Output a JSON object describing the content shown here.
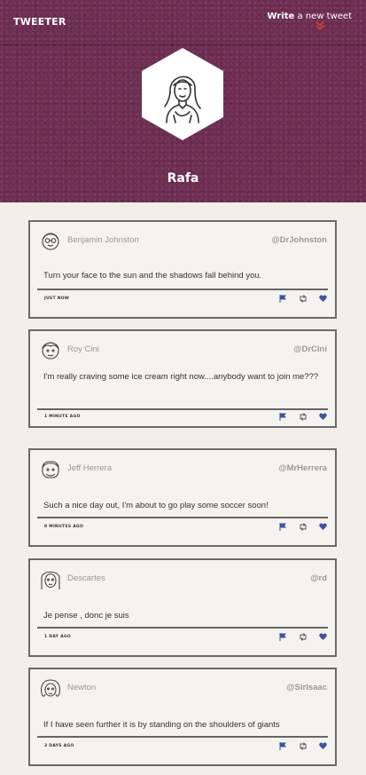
{
  "header": {
    "brand": "TWEETER",
    "write_bold": "Write",
    "write_rest": "a new tweet",
    "profile_name": "Rafa"
  },
  "tweets": [
    {
      "name": "Benjamin Johnston",
      "handle": "@DrJohnston",
      "text": "Turn your face to the sun and the shadows fall behind you.",
      "time": "just now"
    },
    {
      "name": "Roy Cini",
      "handle": "@DrCini",
      "text": "I'm really craving some ice cream right now....anybody want to join me???",
      "time": "1 minute ago"
    },
    {
      "name": "Jeff Herrera",
      "handle": "@MrHerrera",
      "text": "Such a nice day out, I'm about to go play some soccer soon!",
      "time": "8 minutes ago"
    },
    {
      "name": "Descartes",
      "handle": "@rd",
      "text": "Je pense , donc je suis",
      "time": "1 day ago"
    },
    {
      "name": "Newton",
      "handle": "@SirIsaac",
      "text": "If I have seen further it is by standing on the shoulders of giants",
      "time": "3 days ago"
    }
  ],
  "colors": {
    "header_bg": "#6b2c4f",
    "page_bg": "#f2efea",
    "action_icons": "#3f51a0",
    "arrow": "#e23b3b"
  },
  "icons": {
    "tweet_actions": [
      "flag-icon",
      "retweet-icon",
      "heart-icon"
    ],
    "write_arrow": "double-chevron-down-icon"
  }
}
